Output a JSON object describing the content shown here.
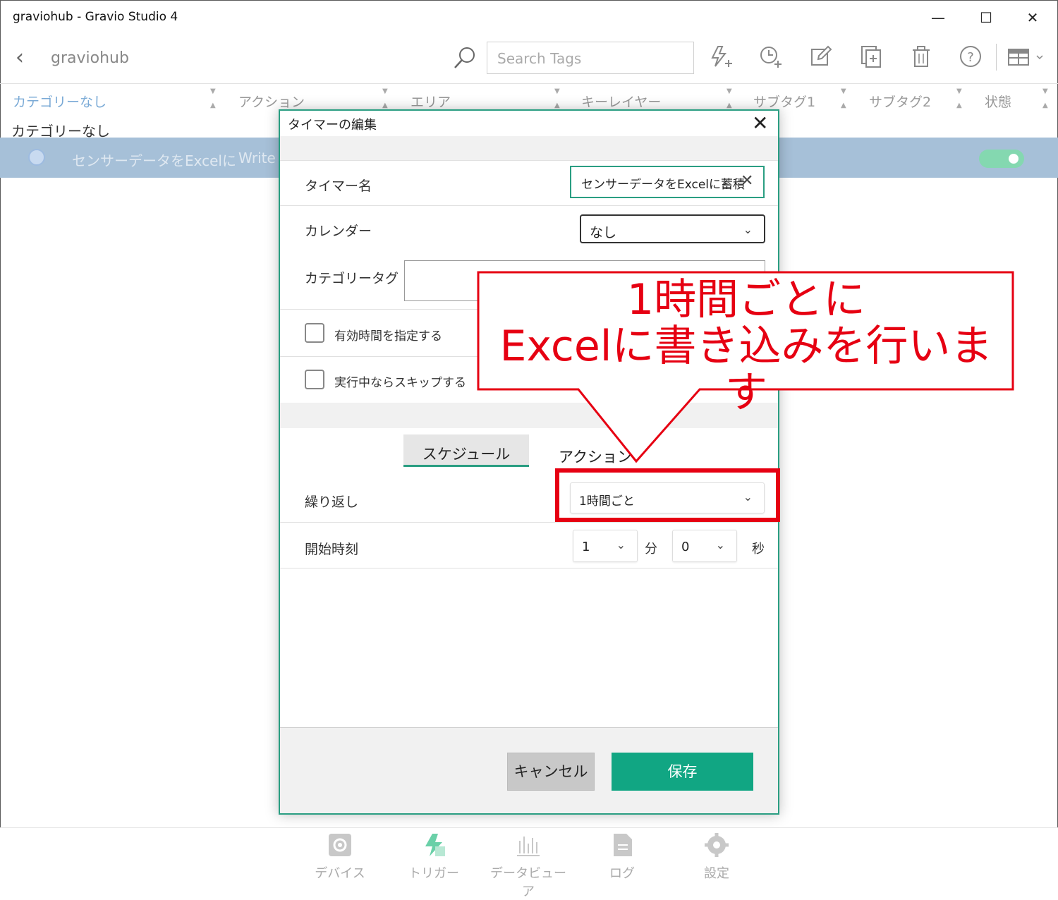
{
  "window": {
    "title": "graviohub - Gravio Studio 4",
    "minimize": "—",
    "maximize": "☐",
    "close": "✕"
  },
  "toolbar": {
    "back": "‹",
    "hub_name": "graviohub",
    "search_placeholder": "Search Tags"
  },
  "columns": [
    "カテゴリーなし",
    "アクション",
    "エリア",
    "キーレイヤー",
    "サブタグ1",
    "サブタグ2",
    "状態"
  ],
  "list": {
    "group_label": "カテゴリーなし",
    "rows": [
      {
        "name": "センサーデータをExcelに",
        "action": "Write",
        "enabled": true
      }
    ]
  },
  "dialog": {
    "title": "タイマーの編集",
    "close": "✕",
    "timer_name_label": "タイマー名",
    "timer_name_value": "センサーデータをExcelに蓄積",
    "clear": "✕",
    "calendar_label": "カレンダー",
    "calendar_value": "なし",
    "category_tag_label": "カテゴリータグ",
    "validity_label": "有効時間を指定する",
    "skip_label": "実行中ならスキップする",
    "tabs": {
      "schedule": "スケジュール",
      "action": "アクション"
    },
    "repeat_label": "繰り返し",
    "repeat_value": "1時間ごと",
    "start_label": "開始時刻",
    "start_minute": "1",
    "minute_unit": "分",
    "start_second": "0",
    "second_unit": "秒",
    "cancel": "キャンセル",
    "save": "保存"
  },
  "callout": {
    "line1": "1時間ごとに",
    "line2": "Excelに書き込みを行います",
    "color": "#e60012"
  },
  "bottom_nav": [
    {
      "label": "デバイス",
      "icon": "gear-icon"
    },
    {
      "label": "トリガー",
      "icon": "trigger-icon"
    },
    {
      "label": "データビューア",
      "icon": "chart-icon"
    },
    {
      "label": "ログ",
      "icon": "log-icon"
    },
    {
      "label": "設定",
      "icon": "settings-icon"
    }
  ],
  "colors": {
    "accent": "#11a683",
    "selection": "#a6c0d8",
    "toggle_on": "#84d8b0"
  }
}
